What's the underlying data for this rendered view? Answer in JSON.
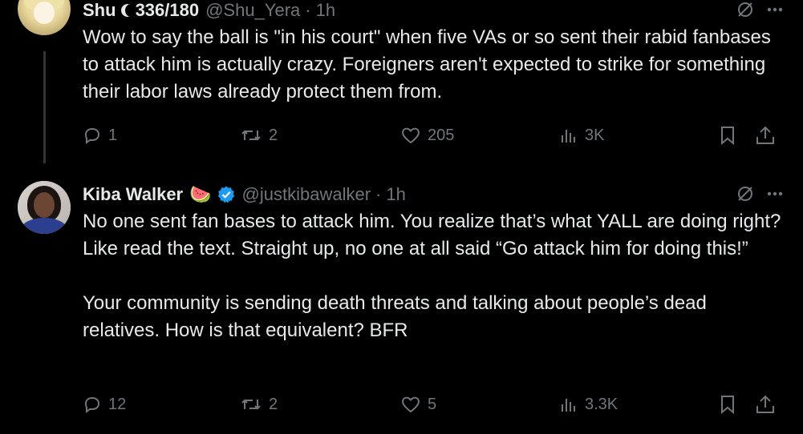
{
  "tweets": [
    {
      "author": {
        "name": "Shu",
        "name_suffix": "336/180",
        "handle": "@Shu_Yera",
        "time": "1h",
        "avatar": "anime-avatar"
      },
      "text": [
        "Wow to say the ball is \"in his court\" when five VAs or so sent their rabid fanbases to attack him is actually crazy. Foreigners aren't expected to strike for something their labor laws already protect them from."
      ],
      "stats": {
        "replies": "1",
        "reposts": "2",
        "likes": "205",
        "views": "3K"
      }
    },
    {
      "author": {
        "name": "Kiba Walker",
        "emoji": "🍉",
        "verified": true,
        "handle": "@justkibawalker",
        "time": "1h",
        "avatar": "profile-photo"
      },
      "text": [
        "No one sent fan bases to attack him. You realize that’s what YALL are doing right? Like read the text. Straight up, no one at all said “Go attack him for doing this!”",
        "Your community is sending death threats and talking about people’s dead relatives. How is that equivalent? BFR"
      ],
      "stats": {
        "replies": "12",
        "reposts": "2",
        "likes": "5",
        "views": "3.3K"
      }
    }
  ],
  "separator": "·",
  "colors": {
    "background": "#000000",
    "text": "#e7e9ea",
    "muted": "#71767b",
    "verified": "#1d9bf0",
    "divider": "#2f3336"
  },
  "icons": [
    "grok-icon",
    "more-icon",
    "reply-icon",
    "repost-icon",
    "like-icon",
    "views-icon",
    "bookmark-icon",
    "share-icon",
    "verified-badge-icon",
    "moon-icon"
  ]
}
